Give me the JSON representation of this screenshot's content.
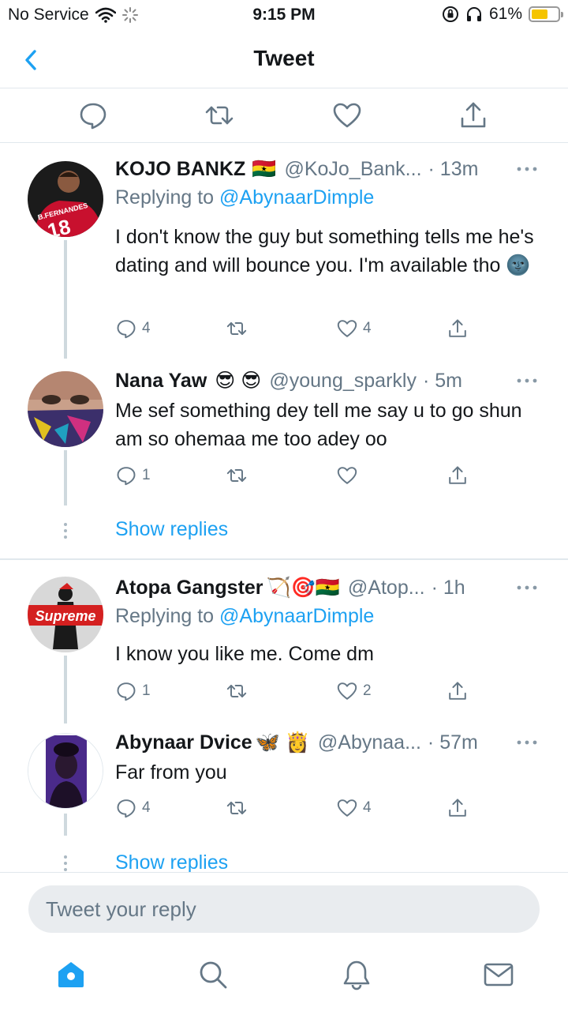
{
  "status_bar": {
    "carrier": "No Service",
    "time": "9:15 PM",
    "battery": "61%",
    "battery_level": 0.61
  },
  "header": {
    "title": "Tweet"
  },
  "replies": [
    {
      "name": "KOJO BANKZ",
      "emojis": "🇬🇭",
      "handle": "@KoJo_Bank...",
      "time": "· 13m",
      "replying_prefix": "Replying to",
      "replying_to": "@AbynaarDimple",
      "text": "I don't know the guy but something tells me he's dating and will bounce you. I'm available tho 🌚",
      "reply_count": "4",
      "retweet_count": "",
      "like_count": "4"
    },
    {
      "name": "Nana Yaw",
      "emojis": "😎 😎",
      "handle": "@young_sparkly",
      "time": "· 5m",
      "text": "Me sef something dey tell me say u to go shun am so ohemaa me too adey oo",
      "reply_count": "1",
      "retweet_count": "",
      "like_count": ""
    },
    {
      "name": "Atopa Gangster",
      "emojis": "🏹🎯🇬🇭",
      "handle": "@Atop...",
      "time": "· 1h",
      "replying_prefix": "Replying to",
      "replying_to": "@AbynaarDimple",
      "text": "I know you like me. Come dm",
      "reply_count": "1",
      "retweet_count": "",
      "like_count": "2"
    },
    {
      "name": "Abynaar Dvice",
      "emojis": "🦋 👸",
      "handle": "@Abynaa...",
      "time": "· 57m",
      "text": "Far from you",
      "reply_count": "4",
      "retweet_count": "",
      "like_count": "4"
    }
  ],
  "show_replies_label": "Show replies",
  "avatar_text": {
    "jersey_name": "B.FERNANDES",
    "jersey_number": "18",
    "brand_logo": "Supreme"
  },
  "composer": {
    "placeholder": "Tweet your reply"
  },
  "tabs": [
    "home-icon",
    "search-icon",
    "notifications-icon",
    "messages-icon"
  ],
  "colors": {
    "accent": "#1da1f2",
    "text": "#14171a",
    "muted": "#657786",
    "battery": "#f5c400"
  }
}
